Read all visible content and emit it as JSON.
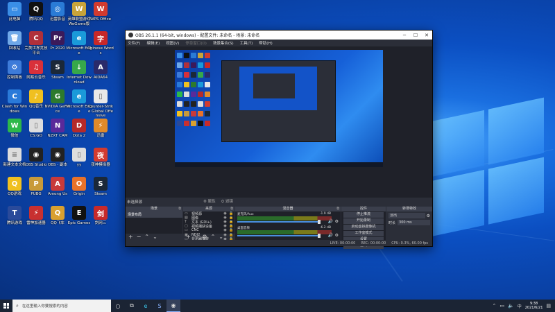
{
  "desktop_icons": [
    {
      "label": "此电脑",
      "color": "#3a8ee6",
      "glyph": "▭"
    },
    {
      "label": "腾讯QQ",
      "color": "#111111",
      "glyph": "Q"
    },
    {
      "label": "迅雷影音",
      "color": "#2a7bd6",
      "glyph": "◎"
    },
    {
      "label": "英雄联盟游戏 WeGame版",
      "color": "#c8a43a",
      "glyph": "W"
    },
    {
      "label": "WPS Office",
      "color": "#d23b2f",
      "glyph": "W"
    },
    {
      "label": "回收站",
      "color": "#6fa8e8",
      "glyph": "🗑"
    },
    {
      "label": "完美世界竞技平台",
      "color": "#b0303a",
      "glyph": "C"
    },
    {
      "label": "Pr 2020",
      "color": "#3b1a5a",
      "glyph": "Pr"
    },
    {
      "label": "Microsoft Edge",
      "color": "#1a9ad9",
      "glyph": "e"
    },
    {
      "label": "Chinese Words",
      "color": "#c82828",
      "glyph": "字"
    },
    {
      "label": "控制面板",
      "color": "#3d7bd9",
      "glyph": "⚙"
    },
    {
      "label": "网易云音乐",
      "color": "#d9303a",
      "glyph": "♫"
    },
    {
      "label": "Steam",
      "color": "#1b2838",
      "glyph": "S"
    },
    {
      "label": "Internet Download",
      "color": "#37a84a",
      "glyph": "↓"
    },
    {
      "label": "AIDA64",
      "color": "#2a2a6a",
      "glyph": "A"
    },
    {
      "label": "Clash for Windows",
      "color": "#2a7ad9",
      "glyph": "C"
    },
    {
      "label": "QQ音乐",
      "color": "#f0c020",
      "glyph": "♪"
    },
    {
      "label": "NVIDIA GeForce",
      "color": "#2d7a2d",
      "glyph": "G"
    },
    {
      "label": "Microsoft Edge",
      "color": "#1a9ad9",
      "glyph": "e"
    },
    {
      "label": "Counter-Strike Global Offensive",
      "color": "#e8e8e8",
      "glyph": "▯"
    },
    {
      "label": "微信",
      "color": "#2db84a",
      "glyph": "W"
    },
    {
      "label": "CS:GO",
      "color": "#dddddd",
      "glyph": "▯"
    },
    {
      "label": "NZXT CAM",
      "color": "#5a2a9a",
      "glyph": "N"
    },
    {
      "label": "Dota 2",
      "color": "#b52a2a",
      "glyph": "D"
    },
    {
      "label": "迅雷",
      "color": "#e08a2a",
      "glyph": "⚡"
    },
    {
      "label": "新建文本文档",
      "color": "#dddddd",
      "glyph": "≡"
    },
    {
      "label": "OBS Studio",
      "color": "#222222",
      "glyph": "◉"
    },
    {
      "label": "OBS - 副本",
      "color": "#222222",
      "glyph": "◉"
    },
    {
      "label": "yy",
      "color": "#dddddd",
      "glyph": "▯"
    },
    {
      "label": "夜神模拟器",
      "color": "#d23b2f",
      "glyph": "夜"
    },
    {
      "label": "QQ游戏",
      "color": "#f0c020",
      "glyph": "Q"
    },
    {
      "label": "PUBG",
      "color": "#c89a3a",
      "glyph": "P"
    },
    {
      "label": "Among Us",
      "color": "#c83a3a",
      "glyph": "A"
    },
    {
      "label": "Origin",
      "color": "#e8722a",
      "glyph": "O"
    },
    {
      "label": "Steam",
      "color": "#1b2838",
      "glyph": "S"
    },
    {
      "label": "腾讯游戏",
      "color": "#2a4a9a",
      "glyph": "T"
    },
    {
      "label": "雷神加速器",
      "color": "#c83030",
      "glyph": "⚡"
    },
    {
      "label": "QQ飞车",
      "color": "#d9a030",
      "glyph": "Q"
    },
    {
      "label": "Epic Games",
      "color": "#111111",
      "glyph": "E"
    },
    {
      "label": "剑网三",
      "color": "#c82a2a",
      "glyph": "剑"
    }
  ],
  "obs": {
    "title": "OBS 26.1.1 (64-bit, windows) - 配置文件: 未命名 - 场景: 未命名",
    "menu": [
      "文件(F)",
      "编辑(E)",
      "视图(V)",
      "停靠窗口(D)",
      "场景集合(S)",
      "工具(T)",
      "帮助(H)"
    ],
    "status_label": "未选择源",
    "props_btn": "⚙ 属性",
    "filters_btn": "⛭ 滤镜",
    "scenes_header": "场景",
    "scenes": [
      "场景布局"
    ],
    "sources_header": "来源",
    "sources": [
      {
        "icon": "▭",
        "label": "视频源"
      },
      {
        "icon": "▧",
        "label": "图像"
      },
      {
        "icon": "T",
        "label": "文本 (GDI+)"
      },
      {
        "icon": "▢",
        "label": "视频捕获设备"
      },
      {
        "icon": "▭",
        "label": "CNC"
      },
      {
        "icon": "▣",
        "label": "NDI2"
      },
      {
        "icon": "▭",
        "label": "显示器捕获"
      },
      {
        "icon": "▧",
        "label": "图片"
      }
    ],
    "mixer_header": "混音器",
    "mixer": [
      {
        "label": "麦克风/Aux",
        "db": "-1.9 dB"
      },
      {
        "label": "桌面音频",
        "db": "-6.2 dB"
      }
    ],
    "controls_header": "控件",
    "controls": [
      "停止推流",
      "开始录制",
      "启动虚拟摄像机",
      "工作室模式",
      "设置",
      "退出"
    ],
    "transitions_header": "转场特效",
    "transition_value": "淡出",
    "duration_label": "时长",
    "duration_value": "300 ms",
    "status_bar": [
      "CPU: 0.3%, 60.00 fps",
      "REC: 00:00:00",
      "LIVE: 00:00:00"
    ]
  },
  "taskbar": {
    "search_placeholder": "在这里输入你要搜索的内容",
    "time": "9:38",
    "date": "2021/6/21"
  }
}
